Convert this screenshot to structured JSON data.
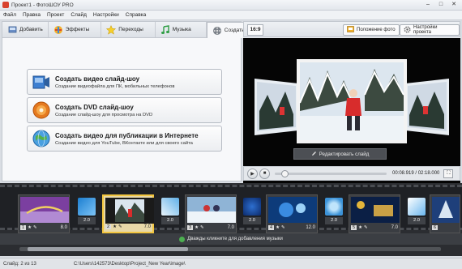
{
  "window": {
    "title": "Проект1 - ФотоШОУ PRO",
    "controls": [
      "–",
      "□",
      "✕"
    ]
  },
  "menu": [
    "Файл",
    "Правка",
    "Проект",
    "Слайд",
    "Настройки",
    "Справка"
  ],
  "tabs": [
    {
      "label": "Добавить",
      "icon": "add-icon"
    },
    {
      "label": "Эффекты",
      "icon": "effects-icon"
    },
    {
      "label": "Переходы",
      "icon": "star-icon"
    },
    {
      "label": "Музыка",
      "icon": "music-icon"
    },
    {
      "label": "Создать",
      "icon": "film-reel-icon",
      "active": true
    }
  ],
  "create_options": [
    {
      "title": "Создать видео слайд-шоу",
      "subtitle": "Создание видеофайла для ПК, мобильных телефонов",
      "icon": "video-file-icon"
    },
    {
      "title": "Создать DVD слайд-шоу",
      "subtitle": "Создание слайд-шоу для просмотра на DVD",
      "icon": "dvd-icon"
    },
    {
      "title": "Создать видео для публикации в Интернете",
      "subtitle": "Создание видео для YouTube, ВКонтакте или для своего сайта",
      "icon": "globe-icon"
    }
  ],
  "right_toolbar": {
    "ratio": "16:9",
    "photo_position": "Положение фото",
    "project_settings": "Настройки проекта"
  },
  "preview": {
    "edit_slide": "Редактировать слайд"
  },
  "player": {
    "time": "00:08.919 / 02:18.000",
    "progress": 0.065
  },
  "timeline": {
    "slides": [
      {
        "num": "1",
        "duration": "8.0",
        "thumb": "purple-title"
      },
      {
        "num": "2",
        "duration": "7.0",
        "thumb": "snow-girl",
        "selected": true
      },
      {
        "num": "3",
        "duration": "7.0",
        "thumb": "snow-kids"
      },
      {
        "num": "4",
        "duration": "12.0",
        "thumb": "blue-art"
      },
      {
        "num": "5",
        "duration": "7.0",
        "thumb": "dark-gold"
      },
      {
        "num": "6",
        "duration": "",
        "thumb": "winter-tree"
      }
    ],
    "transitions": [
      "2.0",
      "2.0",
      "2.0",
      "2.0",
      "2.0",
      "2.0"
    ],
    "music_hint": "Дважды кликните для добавления музыки",
    "scroll_fraction": 0.38
  },
  "status": {
    "slide": "Слайд: 2 из 13",
    "path": "C:\\Users\\142573\\Desktop\\Project_New Year\\image\\"
  },
  "colors": {
    "selected_slide": "#f3c640",
    "timeline_bg": "#2b2d31",
    "preview_bg": "#050505"
  }
}
